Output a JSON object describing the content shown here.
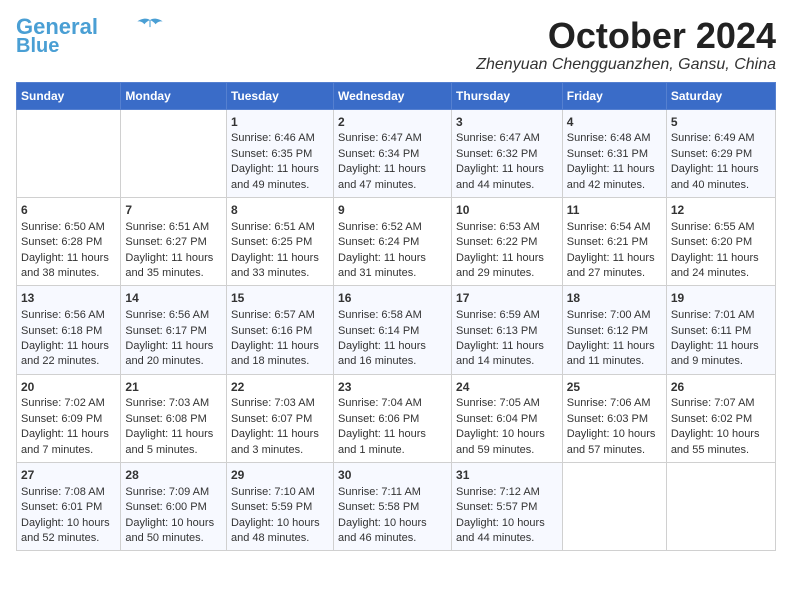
{
  "header": {
    "logo_line1": "General",
    "logo_line2": "Blue",
    "month": "October 2024",
    "location": "Zhenyuan Chengguanzhen, Gansu, China"
  },
  "days_of_week": [
    "Sunday",
    "Monday",
    "Tuesday",
    "Wednesday",
    "Thursday",
    "Friday",
    "Saturday"
  ],
  "weeks": [
    [
      {
        "day": "",
        "content": ""
      },
      {
        "day": "",
        "content": ""
      },
      {
        "day": "1",
        "content": "Sunrise: 6:46 AM\nSunset: 6:35 PM\nDaylight: 11 hours and 49 minutes."
      },
      {
        "day": "2",
        "content": "Sunrise: 6:47 AM\nSunset: 6:34 PM\nDaylight: 11 hours and 47 minutes."
      },
      {
        "day": "3",
        "content": "Sunrise: 6:47 AM\nSunset: 6:32 PM\nDaylight: 11 hours and 44 minutes."
      },
      {
        "day": "4",
        "content": "Sunrise: 6:48 AM\nSunset: 6:31 PM\nDaylight: 11 hours and 42 minutes."
      },
      {
        "day": "5",
        "content": "Sunrise: 6:49 AM\nSunset: 6:29 PM\nDaylight: 11 hours and 40 minutes."
      }
    ],
    [
      {
        "day": "6",
        "content": "Sunrise: 6:50 AM\nSunset: 6:28 PM\nDaylight: 11 hours and 38 minutes."
      },
      {
        "day": "7",
        "content": "Sunrise: 6:51 AM\nSunset: 6:27 PM\nDaylight: 11 hours and 35 minutes."
      },
      {
        "day": "8",
        "content": "Sunrise: 6:51 AM\nSunset: 6:25 PM\nDaylight: 11 hours and 33 minutes."
      },
      {
        "day": "9",
        "content": "Sunrise: 6:52 AM\nSunset: 6:24 PM\nDaylight: 11 hours and 31 minutes."
      },
      {
        "day": "10",
        "content": "Sunrise: 6:53 AM\nSunset: 6:22 PM\nDaylight: 11 hours and 29 minutes."
      },
      {
        "day": "11",
        "content": "Sunrise: 6:54 AM\nSunset: 6:21 PM\nDaylight: 11 hours and 27 minutes."
      },
      {
        "day": "12",
        "content": "Sunrise: 6:55 AM\nSunset: 6:20 PM\nDaylight: 11 hours and 24 minutes."
      }
    ],
    [
      {
        "day": "13",
        "content": "Sunrise: 6:56 AM\nSunset: 6:18 PM\nDaylight: 11 hours and 22 minutes."
      },
      {
        "day": "14",
        "content": "Sunrise: 6:56 AM\nSunset: 6:17 PM\nDaylight: 11 hours and 20 minutes."
      },
      {
        "day": "15",
        "content": "Sunrise: 6:57 AM\nSunset: 6:16 PM\nDaylight: 11 hours and 18 minutes."
      },
      {
        "day": "16",
        "content": "Sunrise: 6:58 AM\nSunset: 6:14 PM\nDaylight: 11 hours and 16 minutes."
      },
      {
        "day": "17",
        "content": "Sunrise: 6:59 AM\nSunset: 6:13 PM\nDaylight: 11 hours and 14 minutes."
      },
      {
        "day": "18",
        "content": "Sunrise: 7:00 AM\nSunset: 6:12 PM\nDaylight: 11 hours and 11 minutes."
      },
      {
        "day": "19",
        "content": "Sunrise: 7:01 AM\nSunset: 6:11 PM\nDaylight: 11 hours and 9 minutes."
      }
    ],
    [
      {
        "day": "20",
        "content": "Sunrise: 7:02 AM\nSunset: 6:09 PM\nDaylight: 11 hours and 7 minutes."
      },
      {
        "day": "21",
        "content": "Sunrise: 7:03 AM\nSunset: 6:08 PM\nDaylight: 11 hours and 5 minutes."
      },
      {
        "day": "22",
        "content": "Sunrise: 7:03 AM\nSunset: 6:07 PM\nDaylight: 11 hours and 3 minutes."
      },
      {
        "day": "23",
        "content": "Sunrise: 7:04 AM\nSunset: 6:06 PM\nDaylight: 11 hours and 1 minute."
      },
      {
        "day": "24",
        "content": "Sunrise: 7:05 AM\nSunset: 6:04 PM\nDaylight: 10 hours and 59 minutes."
      },
      {
        "day": "25",
        "content": "Sunrise: 7:06 AM\nSunset: 6:03 PM\nDaylight: 10 hours and 57 minutes."
      },
      {
        "day": "26",
        "content": "Sunrise: 7:07 AM\nSunset: 6:02 PM\nDaylight: 10 hours and 55 minutes."
      }
    ],
    [
      {
        "day": "27",
        "content": "Sunrise: 7:08 AM\nSunset: 6:01 PM\nDaylight: 10 hours and 52 minutes."
      },
      {
        "day": "28",
        "content": "Sunrise: 7:09 AM\nSunset: 6:00 PM\nDaylight: 10 hours and 50 minutes."
      },
      {
        "day": "29",
        "content": "Sunrise: 7:10 AM\nSunset: 5:59 PM\nDaylight: 10 hours and 48 minutes."
      },
      {
        "day": "30",
        "content": "Sunrise: 7:11 AM\nSunset: 5:58 PM\nDaylight: 10 hours and 46 minutes."
      },
      {
        "day": "31",
        "content": "Sunrise: 7:12 AM\nSunset: 5:57 PM\nDaylight: 10 hours and 44 minutes."
      },
      {
        "day": "",
        "content": ""
      },
      {
        "day": "",
        "content": ""
      }
    ]
  ]
}
